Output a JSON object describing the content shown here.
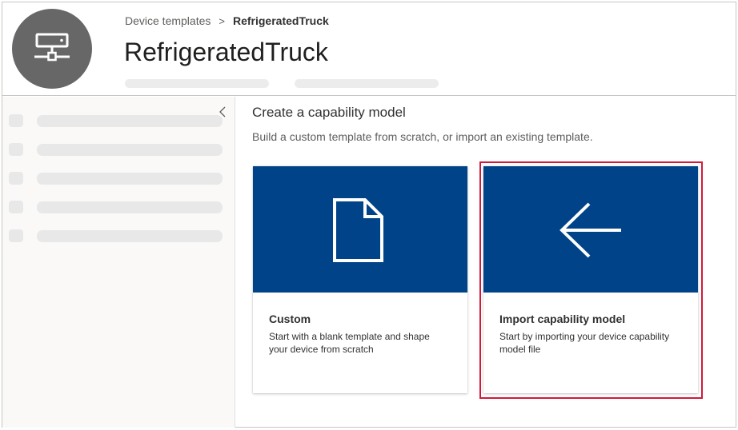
{
  "header": {
    "avatar_icon": "network-device-icon",
    "breadcrumb": {
      "parent": "Device templates",
      "separator": ">",
      "current": "RefrigeratedTruck"
    },
    "title": "RefrigeratedTruck"
  },
  "sidebar": {
    "collapse_icon": "chevron-left-icon",
    "collapse_glyph": "‹",
    "items_count_placeholder": 5
  },
  "main": {
    "title": "Create a capability model",
    "subtitle": "Build a custom template from scratch, or import an existing template.",
    "cards": [
      {
        "icon": "blank-document-icon",
        "title": "Custom",
        "description": "Start with a blank template and shape your device from scratch"
      },
      {
        "icon": "arrow-left-icon",
        "title": "Import capability model",
        "description": "Start by importing your device capability model file"
      }
    ]
  },
  "colors": {
    "card_banner": "#004388",
    "highlight": "#d11a3a",
    "avatar": "#676767"
  }
}
